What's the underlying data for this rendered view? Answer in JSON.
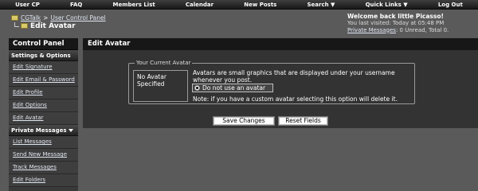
{
  "nav": [
    "User CP",
    "FAQ",
    "Members List",
    "Calendar",
    "New Posts",
    "Search ▼",
    "Quick Links ▼",
    "Log Out"
  ],
  "breadcrumb": {
    "site": "CGTalk",
    "separator": ">",
    "section": "User Control Panel",
    "current": "Edit Avatar"
  },
  "welcome": {
    "greeting": "Welcome back little Picasso!",
    "last_visit_label": "You last visited: Today at ",
    "last_visit_time": "05:48 PM",
    "pm_label": "Private Messages",
    "pm_status": ": 0 Unread, Total 0."
  },
  "sidebar": {
    "title": "Control Panel",
    "cat_settings": "Settings & Options",
    "settings": [
      "Edit Signature",
      "Edit Email & Password",
      "Edit Profile",
      "Edit Options",
      "Edit Avatar"
    ],
    "cat_pm": "Private Messages",
    "pm": [
      "List Messages",
      "Send New Message",
      "Track Messages",
      "Edit Folders"
    ]
  },
  "panel": {
    "title": "Edit Avatar",
    "legend": "Your Current Avatar",
    "no_avatar": "No Avatar Specified",
    "description": "Avatars are small graphics that are displayed under your username whenever you post.",
    "radio_label": "Do not use an avatar",
    "note": "Note: if you have a custom avatar selecting this option will delete it.",
    "save_button": "Save Changes",
    "reset_button": "Reset Fields"
  },
  "colors": {
    "background": "#5a5a5a",
    "header_bar": "#171717",
    "link": "#e0e6f0"
  }
}
